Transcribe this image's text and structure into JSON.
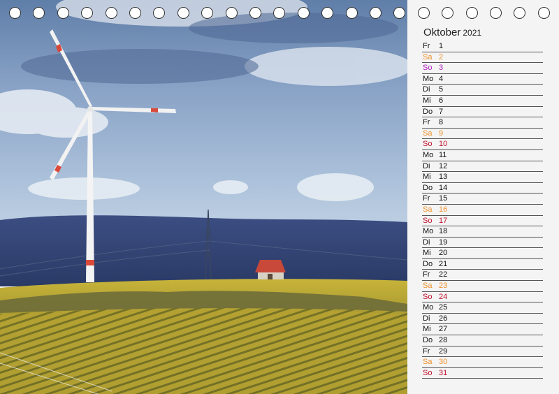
{
  "calendar": {
    "month": "Oktober",
    "year": "2021",
    "colors": {
      "weekday": "#111111",
      "saturday": "#f0902a",
      "sunday": "#c0102a",
      "first_sunday": "#b020c0"
    },
    "days": [
      {
        "wd": "Fr",
        "num": "1",
        "type": "weekday"
      },
      {
        "wd": "Sa",
        "num": "2",
        "type": "saturday"
      },
      {
        "wd": "So",
        "num": "3",
        "type": "first_sunday"
      },
      {
        "wd": "Mo",
        "num": "4",
        "type": "weekday"
      },
      {
        "wd": "Di",
        "num": "5",
        "type": "weekday"
      },
      {
        "wd": "Mi",
        "num": "6",
        "type": "weekday"
      },
      {
        "wd": "Do",
        "num": "7",
        "type": "weekday"
      },
      {
        "wd": "Fr",
        "num": "8",
        "type": "weekday"
      },
      {
        "wd": "Sa",
        "num": "9",
        "type": "saturday"
      },
      {
        "wd": "So",
        "num": "10",
        "type": "sunday"
      },
      {
        "wd": "Mo",
        "num": "11",
        "type": "weekday"
      },
      {
        "wd": "Di",
        "num": "12",
        "type": "weekday"
      },
      {
        "wd": "Mi",
        "num": "13",
        "type": "weekday"
      },
      {
        "wd": "Do",
        "num": "14",
        "type": "weekday"
      },
      {
        "wd": "Fr",
        "num": "15",
        "type": "weekday"
      },
      {
        "wd": "Sa",
        "num": "16",
        "type": "saturday"
      },
      {
        "wd": "So",
        "num": "17",
        "type": "sunday"
      },
      {
        "wd": "Mo",
        "num": "18",
        "type": "weekday"
      },
      {
        "wd": "Di",
        "num": "19",
        "type": "weekday"
      },
      {
        "wd": "Mi",
        "num": "20",
        "type": "weekday"
      },
      {
        "wd": "Do",
        "num": "21",
        "type": "weekday"
      },
      {
        "wd": "Fr",
        "num": "22",
        "type": "weekday"
      },
      {
        "wd": "Sa",
        "num": "23",
        "type": "saturday"
      },
      {
        "wd": "So",
        "num": "24",
        "type": "sunday"
      },
      {
        "wd": "Mo",
        "num": "25",
        "type": "weekday"
      },
      {
        "wd": "Di",
        "num": "26",
        "type": "weekday"
      },
      {
        "wd": "Mi",
        "num": "27",
        "type": "weekday"
      },
      {
        "wd": "Do",
        "num": "28",
        "type": "weekday"
      },
      {
        "wd": "Fr",
        "num": "29",
        "type": "weekday"
      },
      {
        "wd": "Sa",
        "num": "30",
        "type": "saturday"
      },
      {
        "wd": "So",
        "num": "31",
        "type": "sunday"
      }
    ]
  },
  "binding": {
    "ring_count": 23
  }
}
